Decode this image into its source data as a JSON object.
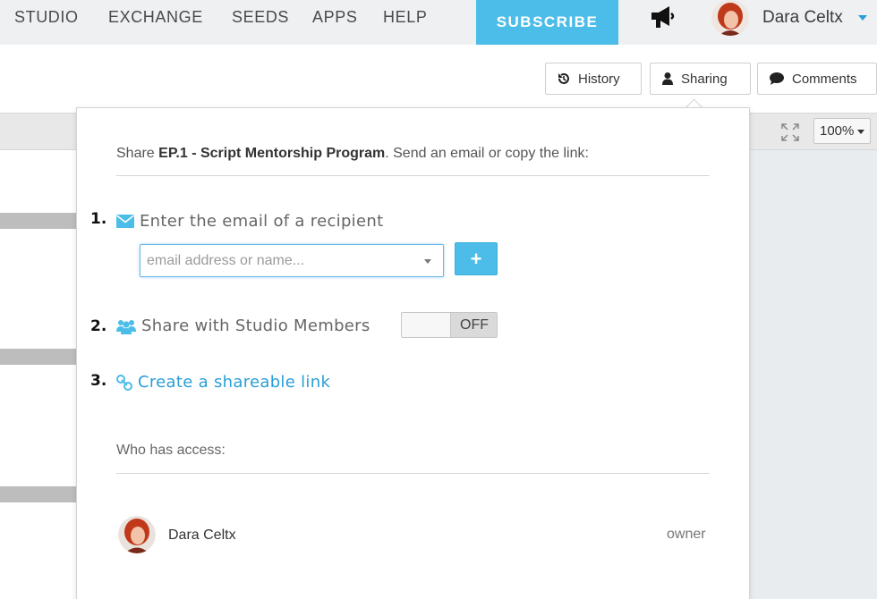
{
  "nav": {
    "links": [
      "STUDIO",
      "EXCHANGE",
      "SEEDS",
      "APPS",
      "HELP"
    ],
    "subscribe": "SUBSCRIBE",
    "announcement_icon": "megaphone-icon",
    "user_name": "Dara Celtx"
  },
  "toolbar": {
    "history": "History",
    "sharing": "Sharing",
    "comments": "Comments",
    "zoom": "100%"
  },
  "share": {
    "prefix": "Share ",
    "doc_title": "EP.1 - Script Mentorship Program",
    "suffix": ". Send an email or copy the link:",
    "step1_num": "1.",
    "step1_label": "Enter the email of a recipient",
    "email_placeholder": "email address or name...",
    "add_label": "+",
    "step2_num": "2.",
    "step2_label": "Share with Studio Members",
    "toggle_state": "OFF",
    "step3_num": "3.",
    "step3_label": "Create a shareable link",
    "access_title": "Who has access:",
    "members": [
      {
        "name": "Dara Celtx",
        "role": "owner"
      }
    ]
  },
  "colors": {
    "accent": "#4cbde8",
    "link": "#2a9fd6"
  }
}
